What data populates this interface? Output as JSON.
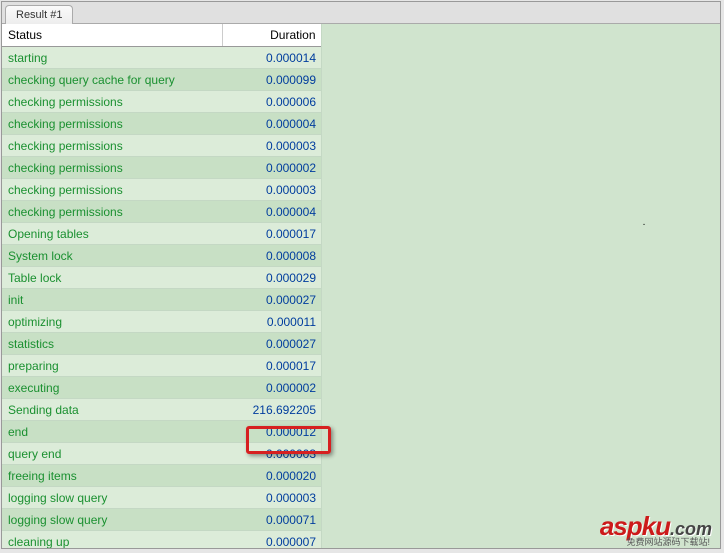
{
  "tab": {
    "label": "Result #1"
  },
  "columns": {
    "status": "Status",
    "duration": "Duration"
  },
  "rows": [
    {
      "status": "starting",
      "duration": "0.000014"
    },
    {
      "status": "checking query cache for query",
      "duration": "0.000099"
    },
    {
      "status": "checking permissions",
      "duration": "0.000006"
    },
    {
      "status": "checking permissions",
      "duration": "0.000004"
    },
    {
      "status": "checking permissions",
      "duration": "0.000003"
    },
    {
      "status": "checking permissions",
      "duration": "0.000002"
    },
    {
      "status": "checking permissions",
      "duration": "0.000003"
    },
    {
      "status": "checking permissions",
      "duration": "0.000004"
    },
    {
      "status": "Opening tables",
      "duration": "0.000017"
    },
    {
      "status": "System lock",
      "duration": "0.000008"
    },
    {
      "status": "Table lock",
      "duration": "0.000029"
    },
    {
      "status": "init",
      "duration": "0.000027"
    },
    {
      "status": "optimizing",
      "duration": "0.000011"
    },
    {
      "status": "statistics",
      "duration": "0.000027"
    },
    {
      "status": "preparing",
      "duration": "0.000017"
    },
    {
      "status": "executing",
      "duration": "0.000002"
    },
    {
      "status": "Sending data",
      "duration": "216.692205"
    },
    {
      "status": "end",
      "duration": "0.000012"
    },
    {
      "status": "query end",
      "duration": "0.000003"
    },
    {
      "status": "freeing items",
      "duration": "0.000020"
    },
    {
      "status": "logging slow query",
      "duration": "0.000003"
    },
    {
      "status": "logging slow query",
      "duration": "0.000071"
    },
    {
      "status": "cleaning up",
      "duration": "0.000007"
    }
  ],
  "highlight_row_index": 16,
  "watermark": {
    "brand": "aspku",
    "tld": ".com",
    "subtitle": "免费网站源码下载站!"
  }
}
